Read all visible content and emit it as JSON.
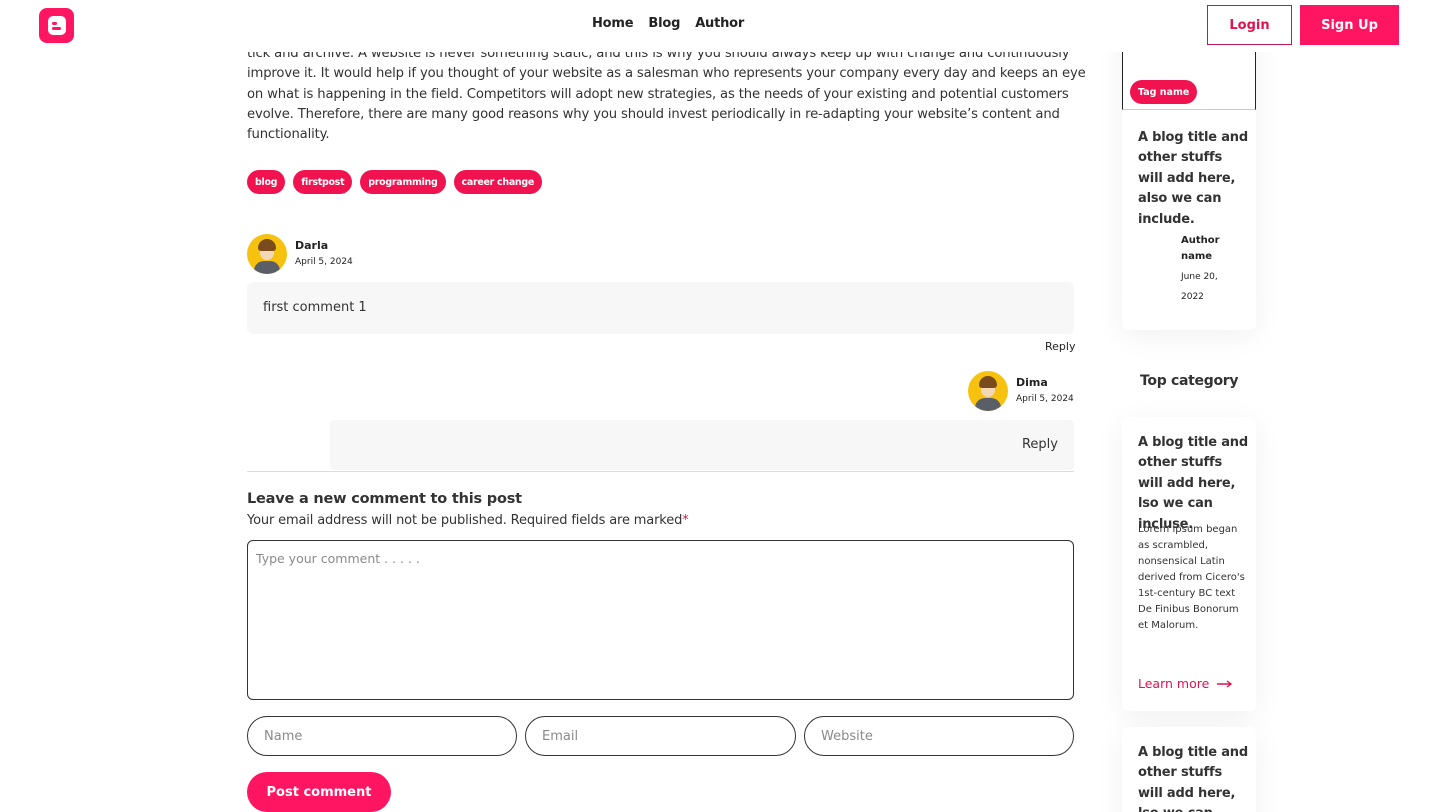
{
  "header": {
    "nav": [
      "Home",
      "Blog",
      "Author"
    ],
    "login_label": "Login",
    "signup_label": "Sign Up"
  },
  "article": {
    "lines": [
      "tick and archive. A website is never something static, and this is why you should always keep up with change and continuously",
      "improve it. It would help if you thought of your website as a salesman who represents your company every day and keeps an eye",
      "on what is happening in the field. Competitors will adopt new strategies, as the needs of your existing and potential customers",
      "evolve. Therefore, there are many good reasons why you should invest periodically in re-adapting your website’s content and",
      "functionality."
    ],
    "tags": [
      "blog",
      "firstpost",
      "programming",
      "career change"
    ]
  },
  "comments": [
    {
      "author": "Darla",
      "date": "April 5, 2024",
      "text": "first comment 1",
      "reply_label": "Reply"
    },
    {
      "author": "Dima",
      "date": "April 5, 2024",
      "reply_label": "Reply"
    }
  ],
  "form": {
    "title": "Leave a new comment to this post",
    "note": "Your email address will not be published. Required fields are marked",
    "required_mark": "*",
    "comment_placeholder": "Type your comment . . . . .",
    "name_placeholder": "Name",
    "email_placeholder": "Email",
    "website_placeholder": "Website",
    "submit_label": "Post comment"
  },
  "sidebar": {
    "top_card": {
      "tag": "Tag name",
      "title": "A blog title and other stuffs will add here, also we can include.",
      "author": "Author name",
      "date": "June 20, 2022"
    },
    "section_title": "Top category",
    "category_card": {
      "title": "A blog title and other stuffs will add here, lso we can incluse.",
      "description": "Lorem ipsum began as scrambled, nonsensical Latin derived from Cicero's 1st-century BC text De Finibus Bonorum et Malorum.",
      "link_label": "Learn more"
    },
    "bottom_card": {
      "title": "A blog title and other stuffs will add here, lso we can incluse."
    }
  },
  "colors": {
    "accent": "#ff1561",
    "text": "#333333"
  }
}
